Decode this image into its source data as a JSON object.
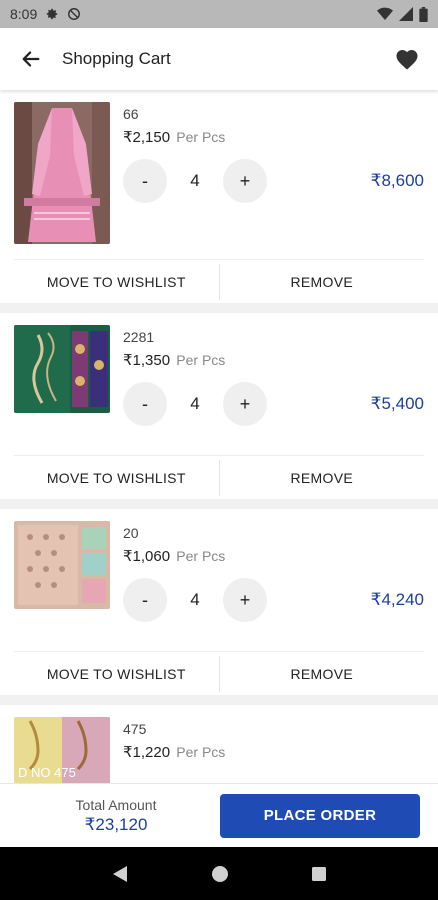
{
  "status_bar": {
    "time": "8:09",
    "left_icons": [
      "gear-icon",
      "do-not-disturb-icon"
    ],
    "right_icons": [
      "wifi-icon",
      "signal-icon",
      "battery-icon"
    ]
  },
  "app_bar": {
    "title": "Shopping Cart",
    "back_icon": "arrow-left-icon",
    "wishlist_icon": "heart-icon"
  },
  "cart_items": [
    {
      "sku": "66",
      "price": "₹2,150",
      "unit": "Per Pcs",
      "qty": "4",
      "line_total": "₹8,600",
      "minus": "-",
      "plus": "+",
      "move_label": "MOVE TO WISHLIST",
      "remove_label": "REMOVE"
    },
    {
      "sku": "2281",
      "price": "₹1,350",
      "unit": "Per Pcs",
      "qty": "4",
      "line_total": "₹5,400",
      "minus": "-",
      "plus": "+",
      "move_label": "MOVE TO WISHLIST",
      "remove_label": "REMOVE"
    },
    {
      "sku": "20",
      "price": "₹1,060",
      "unit": "Per Pcs",
      "qty": "4",
      "line_total": "₹4,240",
      "minus": "-",
      "plus": "+",
      "move_label": "MOVE TO WISHLIST",
      "remove_label": "REMOVE"
    },
    {
      "sku": "475",
      "price": "₹1,220",
      "unit": "Per Pcs",
      "image_text": "D NO 475"
    }
  ],
  "footer": {
    "total_label": "Total Amount",
    "total_value": "₹23,120",
    "place_order_label": "PLACE ORDER"
  },
  "nav_bar": {
    "icons": [
      "back-triangle-icon",
      "home-circle-icon",
      "recents-square-icon"
    ]
  },
  "colors": {
    "accent": "#1e4bb4",
    "price_blue": "#1b3fa0",
    "status_bar": "#b8b8b8",
    "nav_bar": "#000000"
  }
}
